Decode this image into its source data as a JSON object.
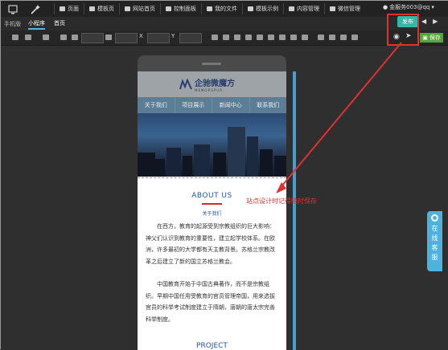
{
  "menu": {
    "items": [
      "页面",
      "模板页",
      "网站首页",
      "控制面板",
      "我的文件",
      "模板示例",
      "内容管理",
      "微信管理"
    ],
    "user": "金服务003@qq"
  },
  "tabs": {
    "mobile": "手机版",
    "mini": "小程序",
    "home": "首页"
  },
  "toolbar": {
    "x_label": "X",
    "y_label": "Y"
  },
  "actions": {
    "publish": "发布",
    "save": "保存"
  },
  "site": {
    "logo_text": "企驰微魔方",
    "logo_sub": "MEMORSPUR",
    "nav": [
      "关于我们",
      "项目展示",
      "新闻中心",
      "联系我们"
    ],
    "about_title": "ABOUT US",
    "about_sub": "关于我们",
    "para1": "在西方，教育的起源受到宗教组织的巨大影响：神父们认识到教育的重要性，建立起学校体系。在欧洲，许多最初的大学都有天主教背景。苏格兰宗教改革之后建立了新的国立苏格兰教会。",
    "para2": "中国教育开始于中国古典著作，而不是宗教组织。早期中国任用受教育的官员管理帝国，用来选拔官员的科举考试制度建立于隋朝，唐朝的唐太宗完善科举制度。",
    "project_title": "PROJECT"
  },
  "annotation": "站点设计时记得随时保存",
  "online_service": [
    "在",
    "线",
    "客",
    "服"
  ],
  "colors": {
    "accent_red": "#e03030",
    "publish": "#36b6a6",
    "save": "#5aa33c",
    "online": "#4eb1de"
  }
}
